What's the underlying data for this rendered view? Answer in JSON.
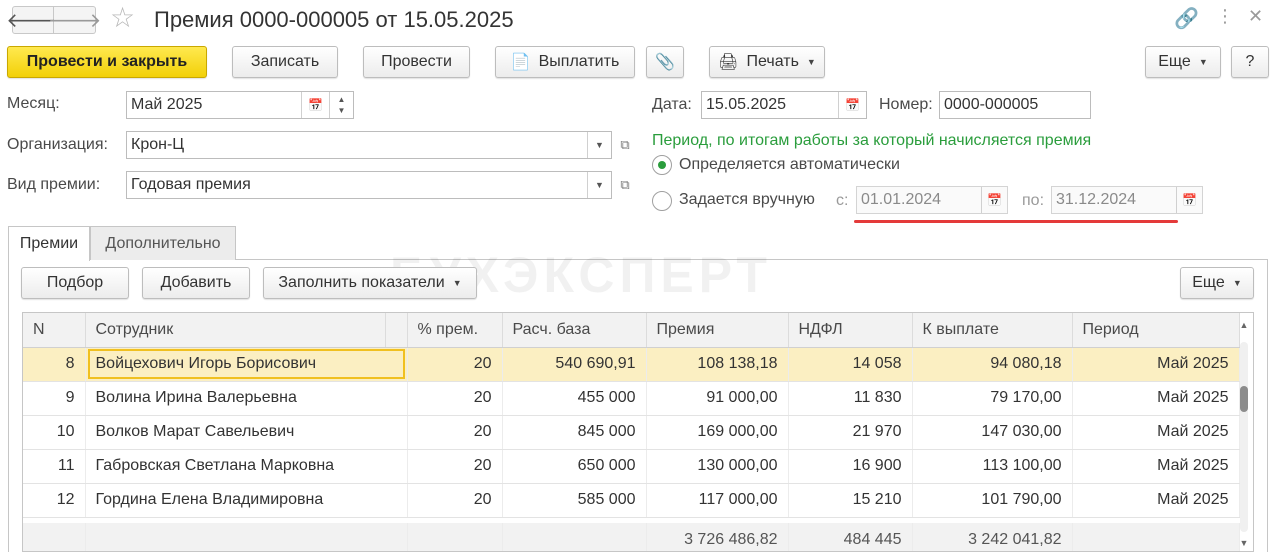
{
  "window": {
    "title": "Премия 0000-000005 от 15.05.2025",
    "back_icon": "arrow-left-icon",
    "forward_icon": "arrow-right-icon",
    "favorite_icon": "star-icon",
    "link_icon": "link-icon",
    "menu_icon": "more-vertical-icon",
    "close_icon": "close-icon"
  },
  "toolbar": {
    "post_close": "Провести и закрыть",
    "save": "Записать",
    "post": "Провести",
    "pay": "Выплатить",
    "print": "Печать",
    "more": "Еще",
    "help": "?"
  },
  "form": {
    "month_label": "Месяц:",
    "month_value": "Май 2025",
    "org_label": "Организация:",
    "org_value": "Крон-Ц",
    "bonus_type_label": "Вид премии:",
    "bonus_type_value": "Годовая премия",
    "date_label": "Дата:",
    "date_value": "15.05.2025",
    "number_label": "Номер:",
    "number_value": "0000-000005",
    "period_note": "Период, по итогам работы за который начисляется премия",
    "auto_option": "Определяется автоматически",
    "manual_option": "Задается вручную",
    "from_label": "с:",
    "from_value": "01.01.2024",
    "to_label": "по:",
    "to_value": "31.12.2024"
  },
  "tabs": [
    {
      "label": "Премии",
      "active": true
    },
    {
      "label": "Дополнительно",
      "active": false
    }
  ],
  "tab_toolbar": {
    "select": "Подбор",
    "add": "Добавить",
    "fill": "Заполнить показатели",
    "more": "Еще"
  },
  "watermark": "БУХЭКСПЕРТ",
  "table": {
    "columns": [
      "N",
      "Сотрудник",
      "% прем.",
      "Расч. база",
      "Премия",
      "НДФЛ",
      "К выплате",
      "Период"
    ],
    "rows": [
      {
        "n": "8",
        "employee": "Войцехович Игорь Борисович",
        "percent": "20",
        "base": "540 690,91",
        "bonus": "108 138,18",
        "ndfl": "14 058",
        "payout": "94 080,18",
        "period": "Май 2025"
      },
      {
        "n": "9",
        "employee": "Волина Ирина Валерьевна",
        "percent": "20",
        "base": "455 000",
        "bonus": "91 000,00",
        "ndfl": "11 830",
        "payout": "79 170,00",
        "period": "Май 2025"
      },
      {
        "n": "10",
        "employee": "Волков Марат Савельевич",
        "percent": "20",
        "base": "845 000",
        "bonus": "169 000,00",
        "ndfl": "21 970",
        "payout": "147 030,00",
        "period": "Май 2025"
      },
      {
        "n": "11",
        "employee": "Габровская Светлана Марковна",
        "percent": "20",
        "base": "650 000",
        "bonus": "130 000,00",
        "ndfl": "16 900",
        "payout": "113 100,00",
        "period": "Май 2025"
      },
      {
        "n": "12",
        "employee": "Гордина Елена Владимировна",
        "percent": "20",
        "base": "585 000",
        "bonus": "117 000,00",
        "ndfl": "15 210",
        "payout": "101 790,00",
        "period": "Май 2025"
      }
    ],
    "totals": {
      "bonus": "3 726 486,82",
      "ndfl": "484 445",
      "payout": "3 242 041,82"
    }
  }
}
